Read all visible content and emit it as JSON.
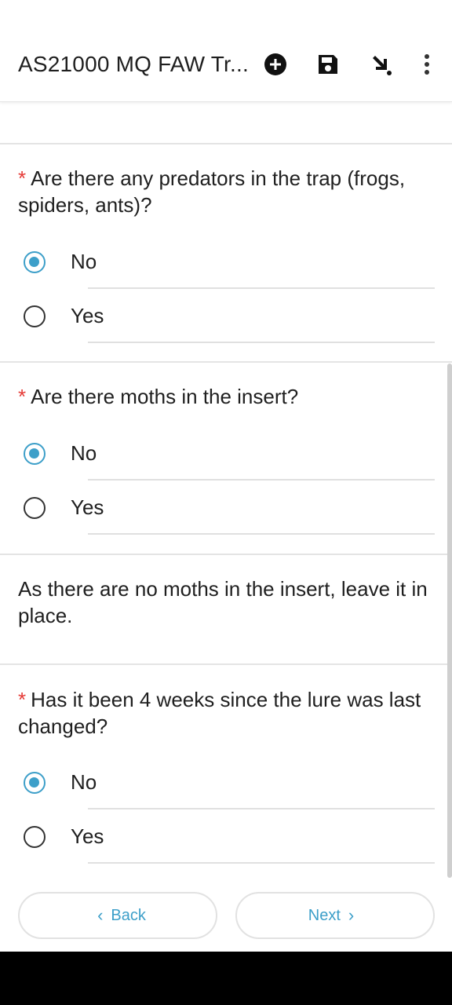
{
  "appbar": {
    "title": "AS21000 MQ FAW Tr...",
    "icons": [
      "add-circle-icon",
      "save-icon",
      "arrow-down-right-icon",
      "more-vert-icon"
    ]
  },
  "questions": [
    {
      "required_mark": "*",
      "text": "Are there any predators in the trap (frogs, spiders, ants)?",
      "options": [
        {
          "label": "No",
          "selected": true
        },
        {
          "label": "Yes",
          "selected": false
        }
      ]
    },
    {
      "required_mark": "*",
      "text": "Are there moths in the insert?",
      "options": [
        {
          "label": "No",
          "selected": true
        },
        {
          "label": "Yes",
          "selected": false
        }
      ]
    },
    {
      "required_mark": "*",
      "text": "Has it been 4 weeks since the lure was last changed?",
      "options": [
        {
          "label": "No",
          "selected": true
        },
        {
          "label": "Yes",
          "selected": false
        }
      ]
    }
  ],
  "note": "As there are no moths in the insert, leave it in place.",
  "footer": {
    "back_label": "Back",
    "next_label": "Next"
  },
  "colors": {
    "accent": "#3d9fc9",
    "required": "#e53935"
  }
}
